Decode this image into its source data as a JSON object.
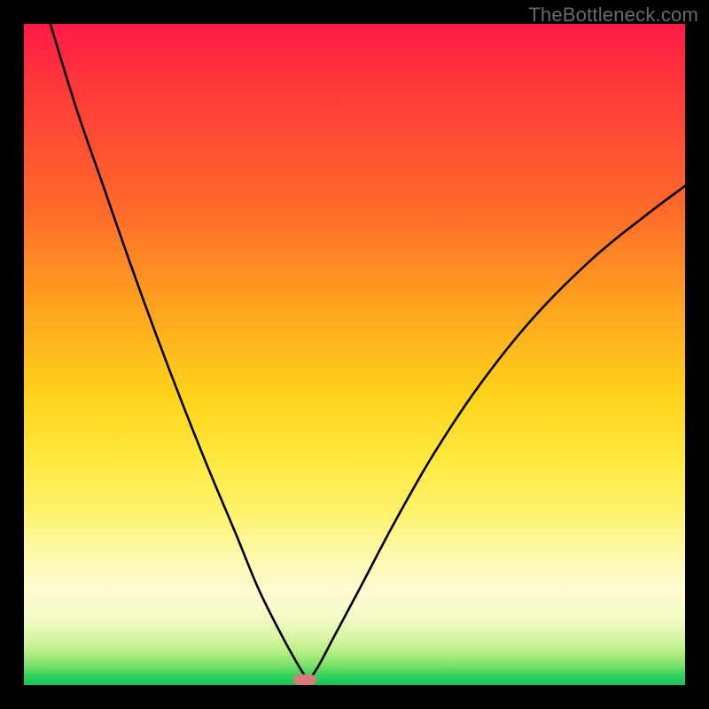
{
  "watermark": "TheBottleneck.com",
  "marker": {
    "x_frac": 0.425,
    "y_frac": 0.992
  },
  "axes": {
    "border_color": "#000000",
    "border_width": 27
  },
  "chart_data": {
    "type": "line",
    "title": "",
    "xlabel": "",
    "ylabel": "",
    "xlim": [
      0,
      1
    ],
    "ylim": [
      0,
      1
    ],
    "series": [
      {
        "name": "left-branch",
        "x": [
          0.04,
          0.08,
          0.12,
          0.16,
          0.2,
          0.24,
          0.28,
          0.32,
          0.355,
          0.39,
          0.415,
          0.43
        ],
        "y": [
          1.0,
          0.87,
          0.755,
          0.64,
          0.53,
          0.425,
          0.325,
          0.23,
          0.145,
          0.075,
          0.03,
          0.006
        ]
      },
      {
        "name": "right-branch",
        "x": [
          0.43,
          0.445,
          0.47,
          0.51,
          0.56,
          0.62,
          0.69,
          0.77,
          0.86,
          0.94,
          1.0
        ],
        "y": [
          0.006,
          0.028,
          0.075,
          0.15,
          0.245,
          0.35,
          0.455,
          0.555,
          0.645,
          0.71,
          0.755
        ]
      }
    ],
    "optimum_marker": {
      "x": 0.425,
      "y": 0.006,
      "color": "#d87a78"
    },
    "background_gradient": [
      "#ff1a46",
      "#ffa41f",
      "#ffe83e",
      "#12c45a"
    ]
  }
}
